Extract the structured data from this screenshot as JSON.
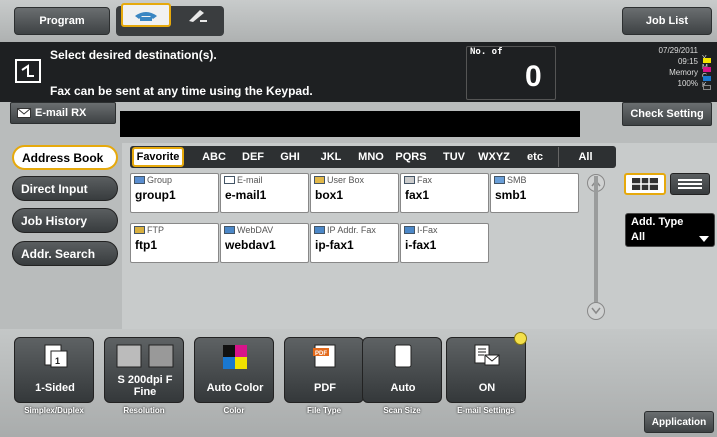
{
  "top": {
    "program_label": "Program",
    "job_list_label": "Job List",
    "mode_fax_icon": "fax-phone-icon",
    "mode_scan_icon": "pen-icon"
  },
  "message": {
    "line1": "Select desired destination(s).",
    "line2": "Fax can be sent at any time using the Keypad.",
    "no_of_label": "No. of",
    "no_of_value": "0"
  },
  "status": {
    "date": "07/29/2011",
    "time": "09:15",
    "memory_label": "Memory",
    "memory_value": "100%",
    "ink": [
      "Y",
      "M",
      "C",
      "K"
    ],
    "ink_colors": [
      "#f2e200",
      "#d8148a",
      "#1a78d0",
      "#222222"
    ],
    "check_setting_label": "Check Setting"
  },
  "email_rx_label": "E-mail RX",
  "nav": [
    "Address Book",
    "Direct Input",
    "Job History",
    "Addr. Search"
  ],
  "filters": [
    "Favorite",
    "ABC",
    "DEF",
    "GHI",
    "JKL",
    "MNO",
    "PQRS",
    "TUV",
    "WXYZ",
    "etc",
    "All"
  ],
  "tiles": [
    {
      "type": "Group",
      "name": "group1",
      "icon": "group-icon"
    },
    {
      "type": "E-mail",
      "name": "e-mail1",
      "icon": "email-icon"
    },
    {
      "type": "User Box",
      "name": "box1",
      "icon": "user-box-icon"
    },
    {
      "type": "Fax",
      "name": "fax1",
      "icon": "fax-icon"
    },
    {
      "type": "SMB",
      "name": "smb1",
      "icon": "smb-icon"
    },
    {
      "type": "FTP",
      "name": "ftp1",
      "icon": "ftp-icon"
    },
    {
      "type": "WebDAV",
      "name": "webdav1",
      "icon": "webdav-icon"
    },
    {
      "type": "IP Addr. Fax",
      "name": "ip-fax1",
      "icon": "ip-fax-icon"
    },
    {
      "type": "I-Fax",
      "name": "i-fax1",
      "icon": "i-fax-icon"
    }
  ],
  "add_type": {
    "label": "Add. Type",
    "value": "All"
  },
  "functions": [
    {
      "value": "1-Sided",
      "label": "Simplex/Duplex",
      "icon": "simplex-icon"
    },
    {
      "value": "S 200dpi F Fine",
      "label": "Resolution",
      "icon": "resolution-icon"
    },
    {
      "value": "Auto Color",
      "label": "Color",
      "icon": "color-icon"
    },
    {
      "value": "PDF",
      "label": "File Type",
      "icon": "pdf-icon"
    },
    {
      "value": "Auto",
      "label": "Scan Size",
      "icon": "scan-size-icon"
    },
    {
      "value": "ON",
      "label": "E-mail Settings",
      "icon": "email-settings-icon"
    }
  ],
  "application_label": "Application",
  "colors": {
    "accent": "#e6a90c",
    "dark_bar": "#1e2022"
  }
}
